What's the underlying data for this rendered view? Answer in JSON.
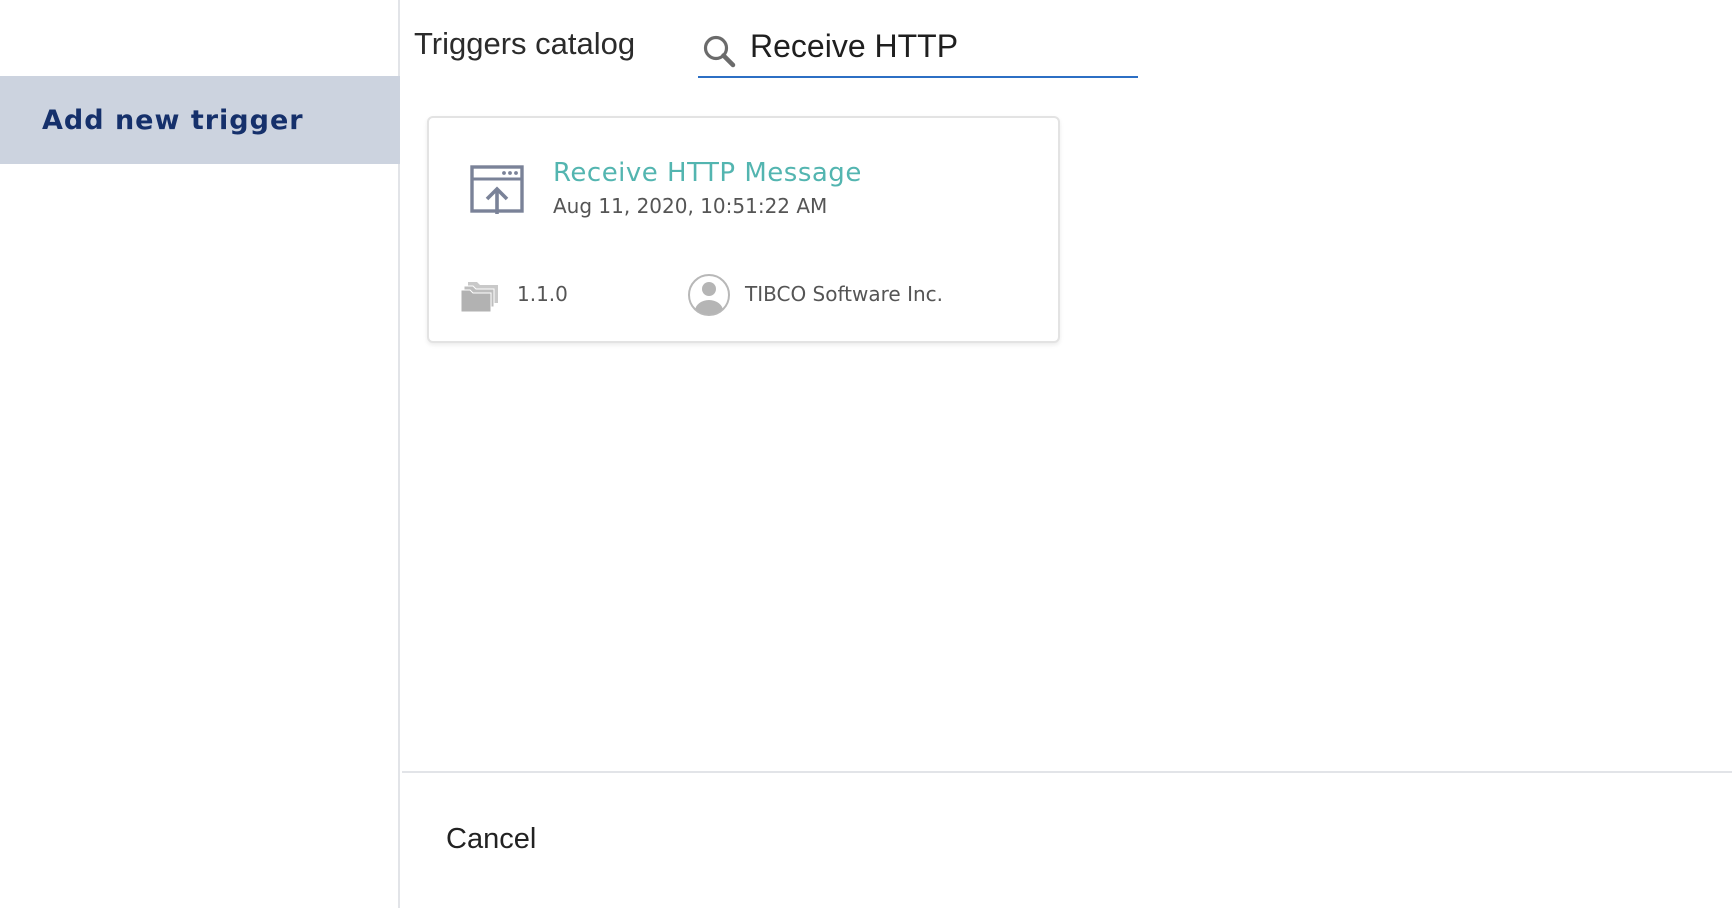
{
  "sidebar": {
    "items": [
      {
        "label": "Add new trigger",
        "selected": true
      }
    ]
  },
  "main": {
    "title": "Triggers catalog",
    "search": {
      "value": "Receive HTTP",
      "icon": "search-icon"
    },
    "results": [
      {
        "name": "Receive HTTP Message",
        "date": "Aug 11, 2020, 10:51:22 AM",
        "version": "1.1.0",
        "vendor": "TIBCO Software Inc.",
        "icon": "http-receive-icon"
      }
    ]
  },
  "footer": {
    "cancel_label": "Cancel"
  },
  "colors": {
    "sidebar_selected_bg": "#ccd3df",
    "sidebar_selected_text": "#15306b",
    "search_underline": "#2c6fc4",
    "card_title": "#53b5b0",
    "icon_slate": "#7a8298",
    "icon_gray": "#b5b5b5"
  }
}
